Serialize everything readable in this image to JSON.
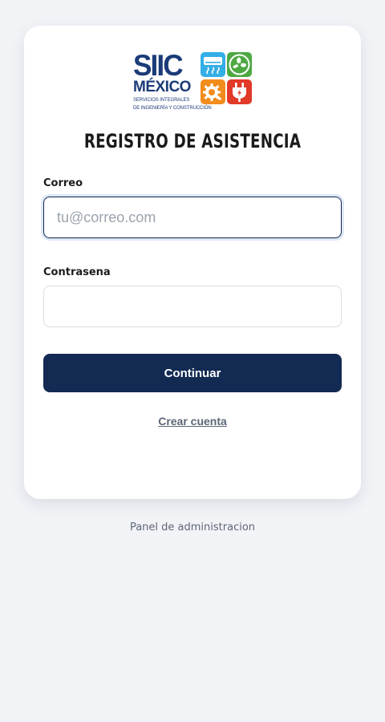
{
  "logo": {
    "name": "SIIC",
    "subname": "MÉXICO",
    "tagline_line1": "SERVICIOS INTEGRALES",
    "tagline_line2": "DE INGENIERÍA Y CONSTRUCCIÓN",
    "tiles": [
      "air-conditioner-icon",
      "fan-icon",
      "gear-wrench-icon",
      "power-plug-icon"
    ],
    "colors": {
      "brand": "#1b3b78",
      "air_conditioner": "#34aee6",
      "fan": "#4ea943",
      "gear": "#f28c1c",
      "plug": "#e13a29"
    }
  },
  "form": {
    "title": "REGISTRO DE ASISTENCIA",
    "email_label": "Correo",
    "email_placeholder": "tu@correo.com",
    "email_value": "",
    "password_label": "Contrasena",
    "password_value": "",
    "submit_label": "Continuar",
    "create_account_link": "Crear cuenta"
  },
  "footer": {
    "admin_link": "Panel de administracion"
  },
  "theme": {
    "page_background": "#f1f3f7",
    "card_background": "#ffffff",
    "primary_button": "#132a52",
    "focus_border": "#13294f"
  }
}
